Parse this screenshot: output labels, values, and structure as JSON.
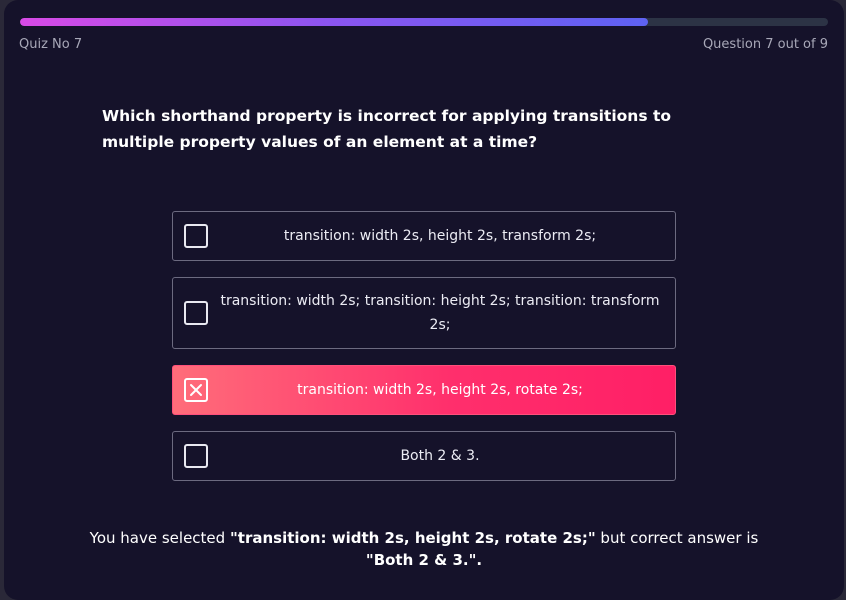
{
  "progress": {
    "current": 7,
    "total": 9
  },
  "header": {
    "quiz_label": "Quiz No 7",
    "counter": "Question 7 out of 9"
  },
  "question": {
    "text": "Which shorthand property is incorrect for applying transitions to multiple property values of an element at a time?"
  },
  "options": [
    {
      "label": "transition: width 2s, height 2s, transform 2s;",
      "selected": false
    },
    {
      "label": "transition: width 2s; transition: height 2s; transition: transform 2s;",
      "selected": false
    },
    {
      "label": "transition: width 2s, height 2s, rotate 2s;",
      "selected": true
    },
    {
      "label": "Both 2 & 3.",
      "selected": false
    }
  ],
  "feedback": {
    "part1": "You have selected ",
    "selected_quoted": "\"transition: width 2s, height 2s, rotate 2s;\"",
    "part2": " but correct answer is ",
    "correct_quoted": "\"Both 2 & 3.\".",
    "part3": ""
  },
  "colors": {
    "background": "#15122a",
    "progress_start": "#d84ae6",
    "progress_end": "#5e62f2",
    "selected_start": "#ff6d7a",
    "selected_end": "#ff1f66"
  },
  "icons": {
    "checkbox_empty": "checkbox-empty-icon",
    "checkbox_crossed": "checkbox-cross-icon"
  }
}
